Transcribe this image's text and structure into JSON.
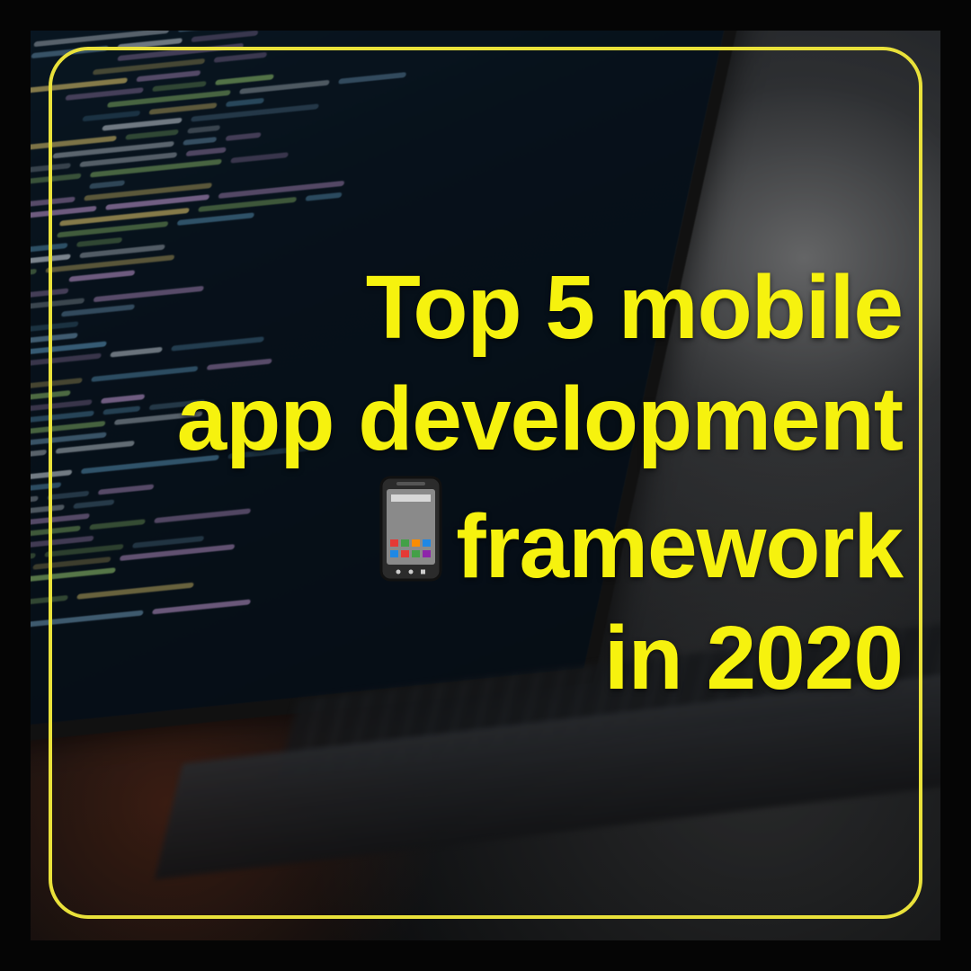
{
  "headline": {
    "line1": "Top 5 mobile",
    "line2": "app development ",
    "line3": "framework",
    "line4": "in 2020"
  },
  "icon": "mobile-phone-icon",
  "colors": {
    "text": "#f6f20e",
    "frame": "#e9e13a",
    "background": "#050505"
  }
}
